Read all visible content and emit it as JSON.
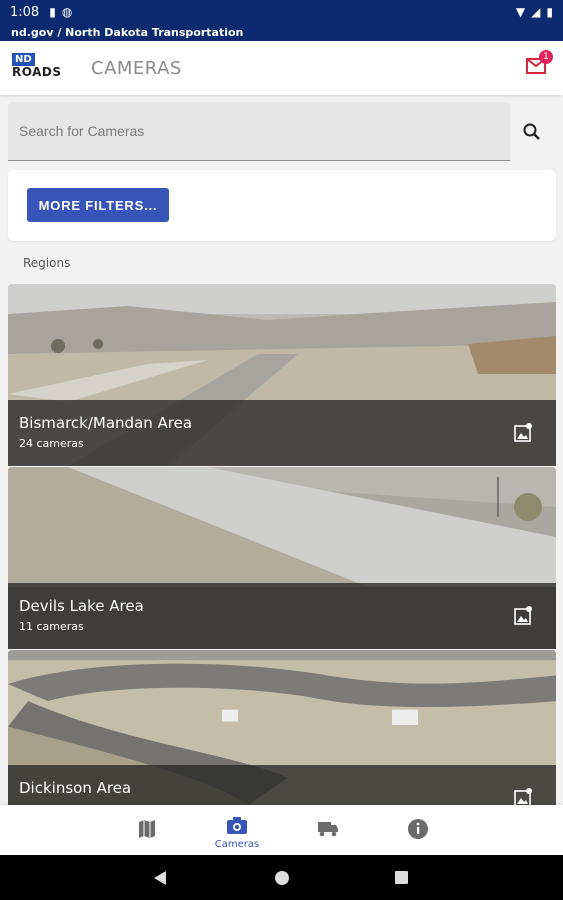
{
  "status_bar": {
    "time": "1:08"
  },
  "url_bar": {
    "text": "nd.gov / North Dakota Transportation"
  },
  "app_bar": {
    "logo_top": "ND",
    "logo_bottom": "ROADS",
    "title": "CAMERAS",
    "mail_badge": "1"
  },
  "search": {
    "placeholder": "Search for Cameras"
  },
  "filters": {
    "button_label": "MORE FILTERS..."
  },
  "regions_label": "Regions",
  "regions": [
    {
      "name": "Bismarck/Mandan Area",
      "count": "24 cameras"
    },
    {
      "name": "Devils Lake Area",
      "count": "11 cameras"
    },
    {
      "name": "Dickinson Area",
      "count": ""
    }
  ],
  "bottom_nav": {
    "items": [
      {
        "icon": "map-icon",
        "label": ""
      },
      {
        "icon": "camera-icon",
        "label": "Cameras"
      },
      {
        "icon": "truck-icon",
        "label": ""
      },
      {
        "icon": "info-icon",
        "label": ""
      }
    ],
    "active": "Cameras"
  },
  "colors": {
    "status_bar": "#0b2a6f",
    "accent": "#3755b8",
    "badge": "#e0245e"
  }
}
